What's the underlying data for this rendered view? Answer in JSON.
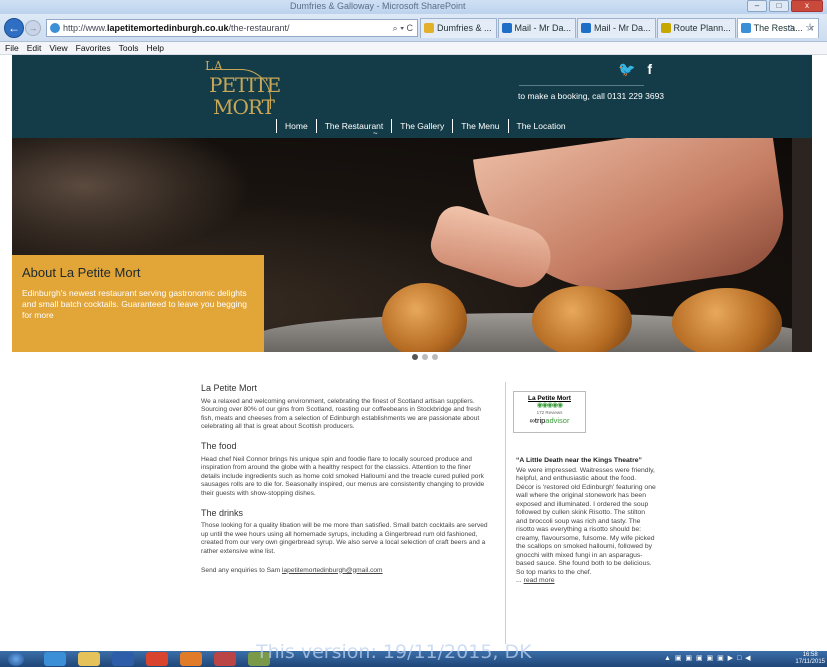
{
  "browser": {
    "window_title": "Dumfries & Galloway - Microsoft SharePoint",
    "url_prefix": "http://www.",
    "url_domain": "lapetitemortedinburgh.co.uk",
    "url_path": "/the-restaurant/",
    "url_tools": "⌕ ▾ C",
    "tabs": [
      {
        "label": "Dumfries & ...",
        "color": "#e2b02a"
      },
      {
        "label": "Mail - Mr Da...",
        "color": "#1e6fc5"
      },
      {
        "label": "Mail - Mr Da...",
        "color": "#1e6fc5"
      },
      {
        "label": "Route Plann...",
        "color": "#c8a600"
      },
      {
        "label": "The Resta...",
        "color": "#3a8fd7",
        "active": true
      }
    ],
    "tab_close": "×",
    "home_star": "⌂ ☆",
    "menu": [
      "File",
      "Edit",
      "View",
      "Favorites",
      "Tools",
      "Help"
    ],
    "win_buttons": [
      "–",
      "□",
      "x"
    ]
  },
  "site": {
    "logo": {
      "line1": "LA",
      "line2": "PETITE",
      "line3": "MORT"
    },
    "social": {
      "twitter": "🐦",
      "facebook": "f"
    },
    "booking": "to make a booking, call 0131 229 3693",
    "nav": [
      "Home",
      "The Restaurant",
      "The Gallery",
      "The Menu",
      "The Location"
    ],
    "nav_tilde": "~",
    "hero": {
      "title": "About La Petite Mort",
      "text": "Edinburgh's newest restaurant serving gastronomic delights and small batch cocktails. Guaranteed to leave you begging for more"
    },
    "slider_dots": 3,
    "content": {
      "intro_title": "La Petite Mort",
      "intro_text": "We a relaxed and welcoming environment, celebrating the finest of Scotland artisan suppliers.  Sourcing over 80% of our gins from Scotland, roasting our coffeebeans in Stockbridge and fresh fish, meats and cheeses from a selection of Edinburgh establishments we are passionate about celebrating all that is great about Scottish producers.",
      "food_title": "The food",
      "food_text": "Head chef Neil Connor brings his unique spin and foodie flare to locally sourced produce and inspiration from around the globe with a healthy respect for the classics. Attention to the finer details include ingredients such as home cold smoked Halloumi and the treacle cured pulled pork sausages rolls are to die for. Seasonally inspired, our menus are consistently changing to provide their guests with show-stopping dishes.",
      "drinks_title": "The drinks",
      "drinks_text": "Those looking for a quality libation will be me more than satisfied. Small batch cocktails are served up until the wee hours using all homemade syrups, including a Gingerbread rum old fashioned, created from our very own gingerbread syrup. We also serve a local selection of craft beers and a rather extensive wine list.",
      "enquiries_prefix": "Send any enquiries to Sam ",
      "enquiries_email": "lapetitemortedinburgh@gmail.com"
    },
    "tripadvisor": {
      "name": "La Petite Mort",
      "rating_circles": "◉◉◉◉◉",
      "reviews": "172 Reviews",
      "brand_prefix": "∞",
      "brand_trip": "trip",
      "brand_advisor": "advisor"
    },
    "review": {
      "title": "“A Little Death near the Kings Theatre”",
      "text": "We were impressed. Waitresses were friendly, helpful, and enthusiastic about the food. Décor is 'restored old Edinburgh' featuring one wall where the original stonework has been exposed and illuminated. I ordered the soup followed by cullen skink Risotto. The stilton and broccoli soup was rich and tasty. The risotto was everything a risotto should be: creamy, flavoursome, fulsome. My wife picked the scallops on smoked halloumi, followed by gnocchi with mixed fungi in an asparagus-based sauce. She found both to be delicious. So top marks to the chef.",
      "more_prefix": "... ",
      "more": "read more"
    }
  },
  "taskbar": {
    "watermark": "This version: 19/11/2015, DK",
    "tray": "▲ ▣ ▣ ▣ ▣ ▣ ▶ □ ◀",
    "time": "16:58",
    "date": "17/11/2015"
  }
}
